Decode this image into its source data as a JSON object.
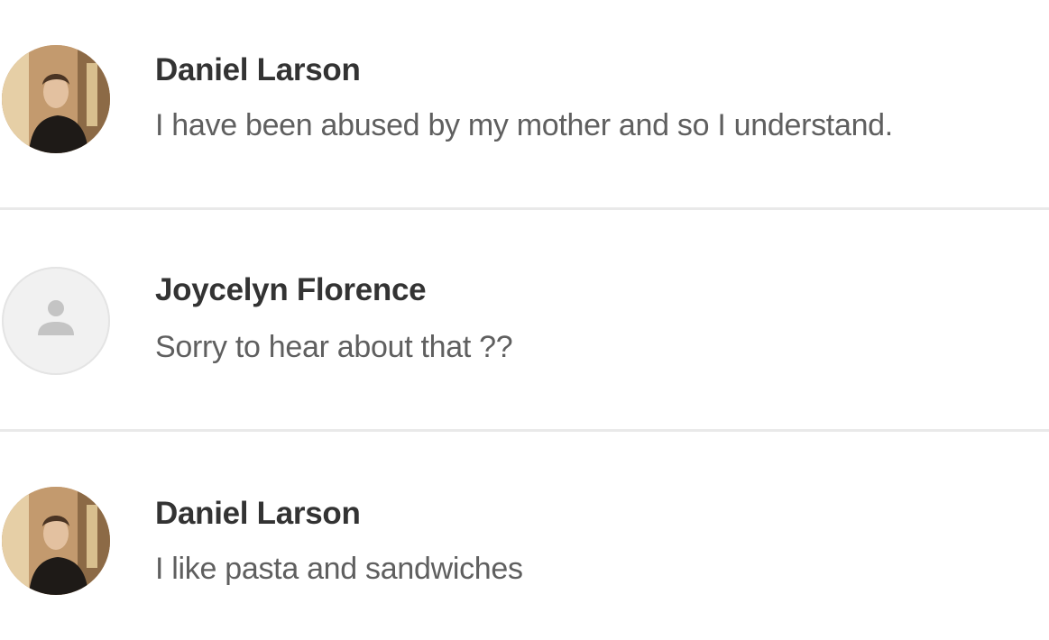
{
  "messages": [
    {
      "name": "Daniel Larson",
      "text": "I have been abused by my mother and so I understand.",
      "avatar_icon": "user-photo-icon"
    },
    {
      "name": "Joycelyn Florence",
      "text": "Sorry to hear about that ??",
      "avatar_icon": "default-user-icon"
    },
    {
      "name": "Daniel Larson",
      "text": "I like pasta and sandwiches",
      "avatar_icon": "user-photo-icon"
    }
  ],
  "colors": {
    "name_text": "#333333",
    "message_text": "#5f5f5f",
    "divider": "#e9e9e9",
    "background": "#ffffff"
  }
}
